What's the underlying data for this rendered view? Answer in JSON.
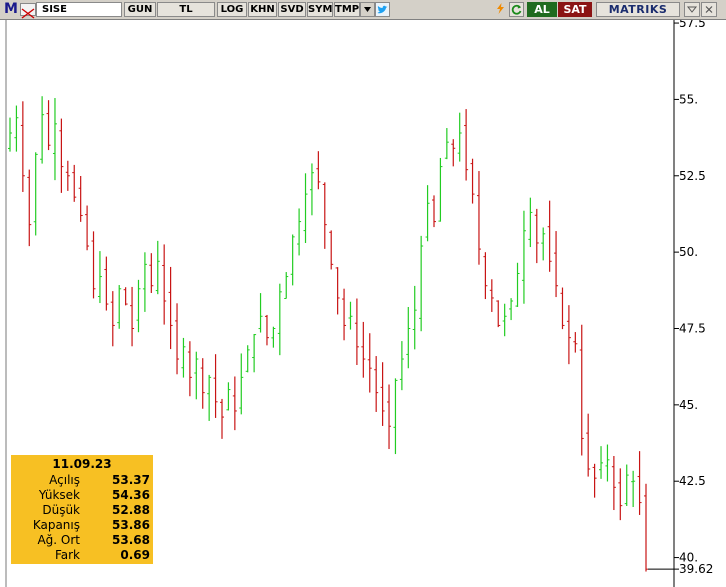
{
  "toolbar": {
    "symbol": "SISE",
    "buttons": [
      "GUN",
      "TL",
      "LOG",
      "KHN",
      "SVD",
      "SYM",
      "TMP"
    ],
    "buy_label": "AL",
    "sell_label": "SAT",
    "brand": "MATRIKS",
    "logo": "M"
  },
  "chart_data": {
    "type": "bar",
    "style": "ohlc",
    "y_ticks": [
      "57.5",
      "55.",
      "52.5",
      "50.",
      "47.5",
      "45.",
      "42.5",
      "40."
    ],
    "ylim": [
      39.2,
      57.6
    ],
    "last_price": "39.62",
    "up_color": "#22cc22",
    "down_color": "#c81414",
    "closes": [
      53.9,
      54.4,
      52.5,
      50.9,
      53.2,
      54.5,
      53.5,
      54.2,
      52.8,
      52.5,
      51.8,
      51.2,
      50.2,
      48.8,
      49.2,
      48.3,
      47.6,
      48.8,
      48.3,
      47.5,
      48.8,
      49.6,
      48.9,
      49.7,
      48.4,
      47.6,
      46.5,
      46.9,
      45.9,
      46.5,
      45.4,
      45.9,
      45.1,
      44.6,
      45.5,
      44.8,
      45.9,
      46.8,
      47.3,
      47.9,
      47.2,
      47.5,
      48.7,
      49.2,
      50.5,
      51.0,
      51.9,
      52.6,
      52.3,
      50.9,
      49.6,
      48.5,
      47.6,
      47.9,
      46.9,
      46.5,
      46.2,
      45.4,
      44.8,
      44.3,
      45.8,
      46.5,
      47.5,
      48.1,
      50.2,
      51.6,
      51.0,
      52.8,
      53.6,
      53.4,
      53.9,
      52.7,
      51.9,
      50.1,
      48.9,
      48.5,
      47.6,
      47.9,
      48.4,
      49.3,
      50.7,
      51.3,
      50.3,
      50.6,
      49.7,
      48.9,
      47.6,
      47.2,
      47.0,
      43.9,
      42.9,
      42.6,
      43.1,
      43.2,
      42.3,
      41.7,
      42.7,
      42.5,
      41.8,
      39.62
    ],
    "info_box": {
      "date": "11.09.23",
      "rows": [
        {
          "label": "Açılış",
          "value": "53.37"
        },
        {
          "label": "Yüksek",
          "value": "54.36"
        },
        {
          "label": "Düşük",
          "value": "52.88"
        },
        {
          "label": "Kapanış",
          "value": "53.86"
        },
        {
          "label": "Ağ. Ort",
          "value": "53.68"
        },
        {
          "label": "Fark",
          "value": "0.69"
        }
      ]
    }
  }
}
